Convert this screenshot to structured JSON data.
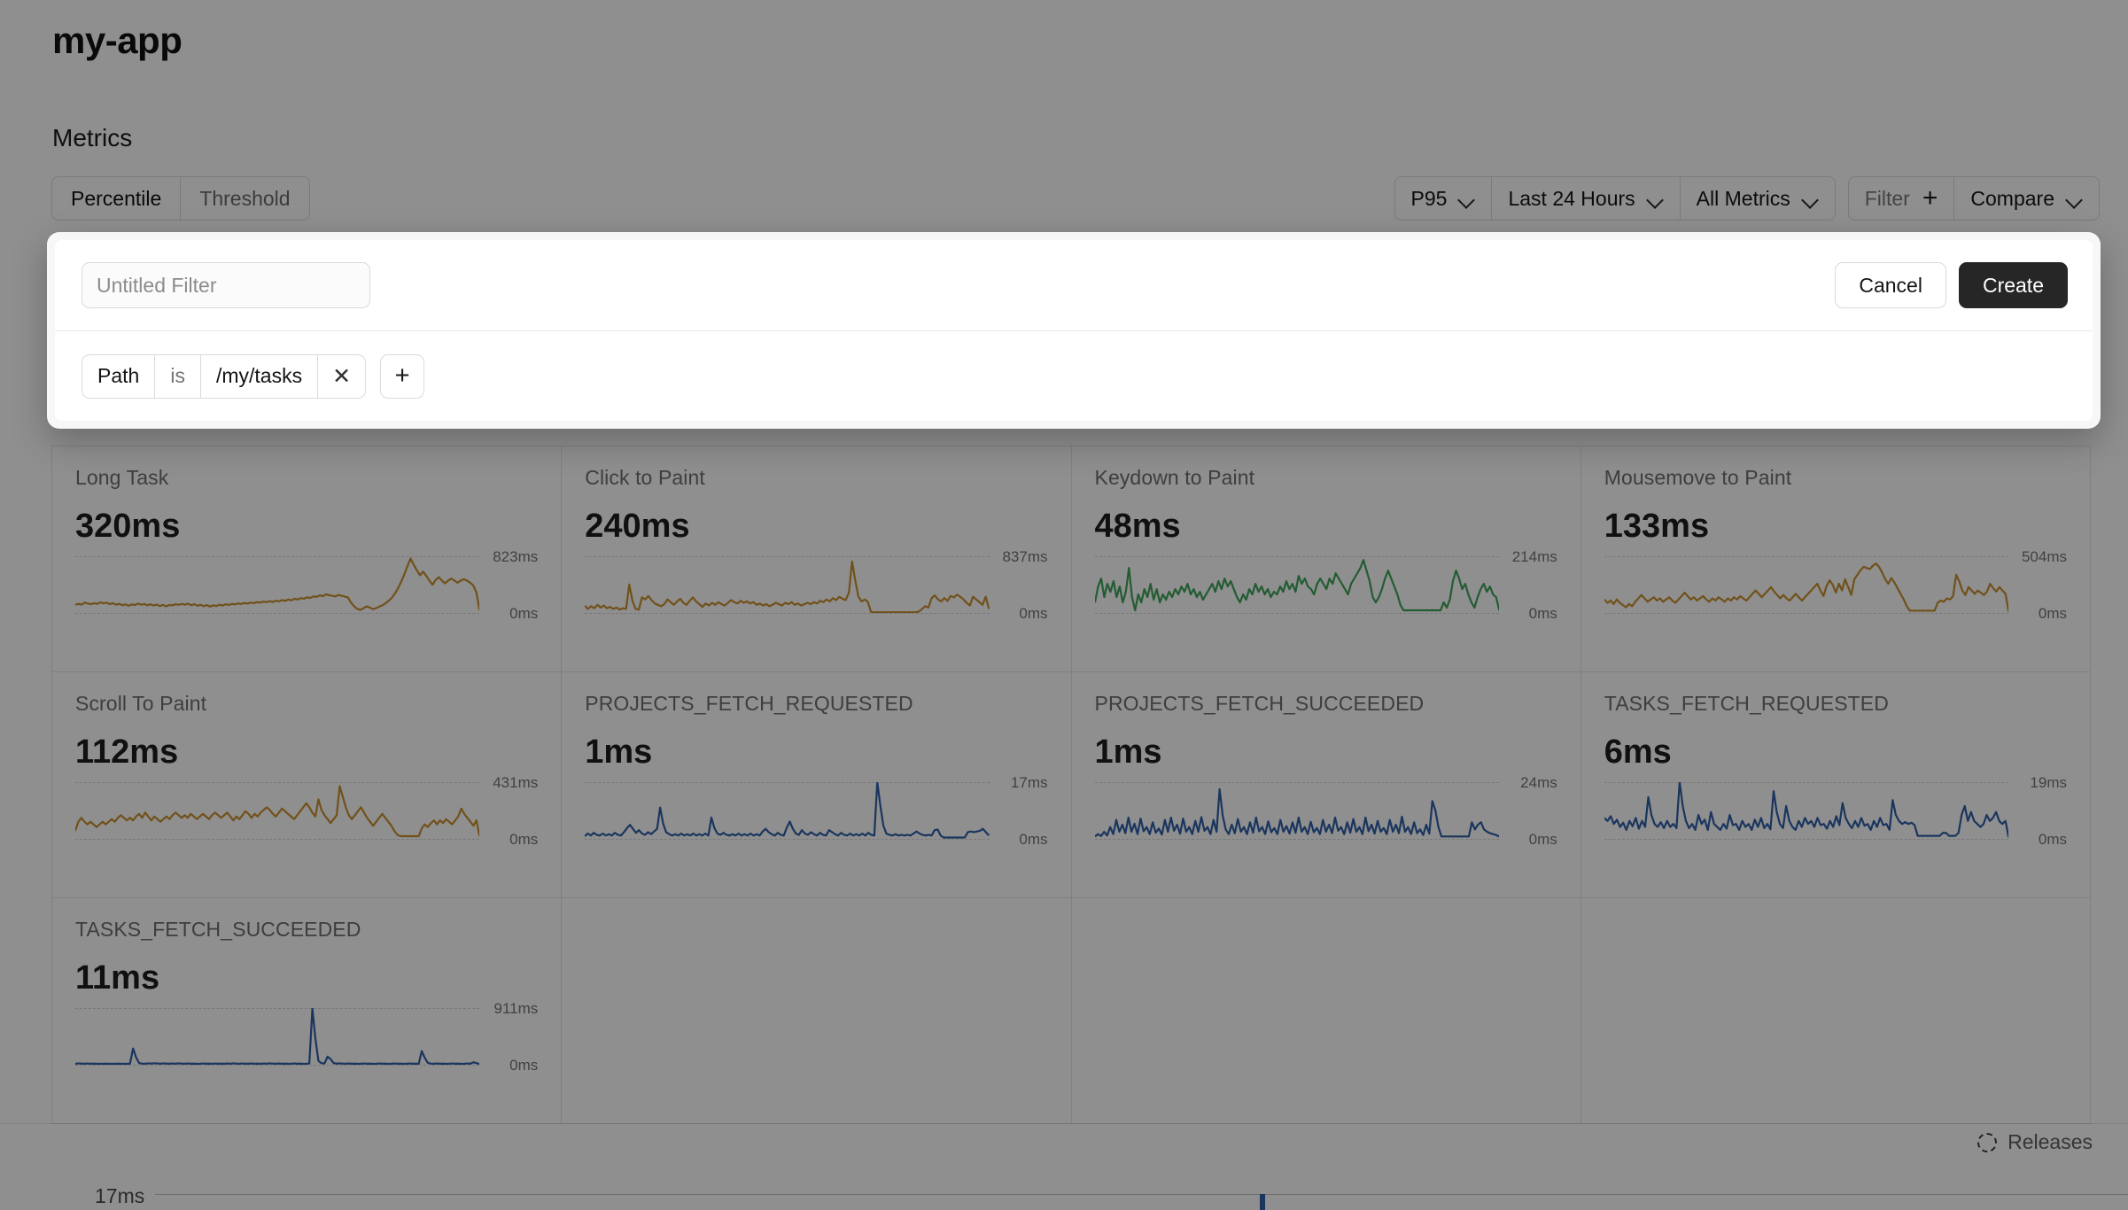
{
  "header": {
    "app_title": "my-app",
    "section_title": "Metrics"
  },
  "segmented": {
    "items": [
      {
        "label": "Percentile",
        "active": true
      },
      {
        "label": "Threshold",
        "active": false
      }
    ]
  },
  "toolbar": {
    "percentile": "P95",
    "time_range": "Last 24 Hours",
    "metric_scope": "All Metrics",
    "filter_label": "Filter",
    "add_filter_icon": "plus-icon",
    "compare_label": "Compare",
    "chevron_icon": "chevron-down-icon"
  },
  "modal": {
    "name_placeholder": "Untitled Filter",
    "name_value": "",
    "cancel_label": "Cancel",
    "create_label": "Create",
    "conditions": [
      {
        "field": "Path",
        "operator": "is",
        "value": "/my/tasks",
        "remove_icon": "close-icon"
      }
    ],
    "add_condition_icon": "plus-icon"
  },
  "bottom": {
    "releases_label": "Releases",
    "releases_icon": "dashed-circle-icon",
    "axis_label": "17ms"
  },
  "colors": {
    "amber": "#c9902f",
    "green": "#3fa45a",
    "blue": "#2f5fa8",
    "accent_dark": "#262626"
  },
  "chart_data": [
    {
      "type": "line",
      "title": "Long Task",
      "value": "320ms",
      "ymax_label": "823ms",
      "ymin_label": "0ms",
      "ylim": [
        0,
        823
      ],
      "color": "#c9902f",
      "highlighted": false,
      "values": [
        118,
        132,
        122,
        150,
        138,
        128,
        142,
        132,
        154,
        140,
        150,
        128,
        142,
        120,
        134,
        112,
        126,
        104,
        124,
        116,
        136,
        120,
        130,
        112,
        126,
        108,
        122,
        100,
        118,
        96,
        116,
        110,
        128,
        118,
        132,
        120,
        136,
        112,
        128,
        104,
        120,
        98,
        116,
        92,
        112,
        100,
        120,
        108,
        126,
        116,
        132,
        124,
        140,
        130,
        146,
        136,
        152,
        142,
        158,
        150,
        166,
        156,
        172,
        160,
        178,
        168,
        188,
        176,
        196,
        184,
        206,
        196,
        216,
        206,
        228,
        218,
        242,
        232,
        256,
        244,
        270,
        258,
        250,
        240,
        262,
        250,
        238,
        226,
        150,
        96,
        60,
        44,
        70,
        96,
        78,
        56,
        70,
        92,
        112,
        140,
        176,
        220,
        280,
        360,
        452,
        560,
        680,
        790,
        700,
        620,
        548,
        600,
        540,
        470,
        410,
        480,
        520,
        470,
        430,
        470,
        500,
        470,
        440,
        470,
        490,
        470,
        440,
        400,
        300,
        40
      ]
    },
    {
      "type": "line",
      "title": "Click to Paint",
      "value": "240ms",
      "ymax_label": "837ms",
      "ymin_label": "0ms",
      "ylim": [
        0,
        837
      ],
      "color": "#c9902f",
      "highlighted": false,
      "values": [
        110,
        60,
        100,
        70,
        120,
        80,
        110,
        70,
        90,
        60,
        80,
        50,
        70,
        60,
        420,
        180,
        60,
        50,
        230,
        200,
        250,
        190,
        140,
        120,
        100,
        130,
        200,
        160,
        120,
        170,
        210,
        150,
        120,
        180,
        230,
        170,
        130,
        90,
        140,
        110,
        150,
        120,
        160,
        130,
        110,
        150,
        190,
        160,
        140,
        180,
        150,
        170,
        140,
        160,
        120,
        140,
        110,
        130,
        100,
        120,
        150,
        130,
        110,
        150,
        130,
        160,
        120,
        140,
        110,
        130,
        150,
        130,
        160,
        140,
        180,
        160,
        200,
        170,
        220,
        190,
        240,
        210,
        190,
        300,
        760,
        480,
        240,
        170,
        200,
        160,
        10,
        10,
        10,
        10,
        10,
        10,
        10,
        10,
        10,
        10,
        10,
        10,
        10,
        10,
        10,
        20,
        60,
        100,
        80,
        220,
        260,
        200,
        170,
        220,
        180,
        250,
        230,
        270,
        240,
        200,
        150,
        110,
        240,
        200,
        160,
        120,
        240,
        60
      ]
    },
    {
      "type": "line",
      "title": "Keydown to Paint",
      "value": "48ms",
      "ymax_label": "214ms",
      "ymin_label": "0ms",
      "ylim": [
        0,
        214
      ],
      "color": "#3fa45a",
      "highlighted": false,
      "values": [
        40,
        100,
        130,
        60,
        110,
        80,
        120,
        60,
        100,
        40,
        80,
        170,
        60,
        10,
        70,
        40,
        90,
        60,
        110,
        50,
        90,
        40,
        70,
        50,
        80,
        60,
        90,
        70,
        100,
        80,
        110,
        70,
        90,
        60,
        80,
        50,
        70,
        90,
        110,
        80,
        120,
        90,
        130,
        100,
        120,
        90,
        60,
        40,
        70,
        50,
        90,
        70,
        110,
        80,
        100,
        70,
        90,
        60,
        80,
        70,
        100,
        80,
        120,
        90,
        110,
        80,
        140,
        110,
        130,
        100,
        90,
        70,
        110,
        130,
        110,
        90,
        130,
        110,
        150,
        130,
        110,
        90,
        70,
        110,
        130,
        150,
        170,
        200,
        160,
        120,
        60,
        40,
        60,
        90,
        130,
        160,
        130,
        100,
        70,
        30,
        10,
        10,
        10,
        10,
        10,
        10,
        10,
        10,
        10,
        10,
        10,
        10,
        10,
        40,
        20,
        50,
        120,
        160,
        130,
        90,
        110,
        70,
        40,
        20,
        60,
        90,
        110,
        80,
        100,
        70,
        60,
        10
      ]
    },
    {
      "type": "line",
      "title": "Mousemove to Paint",
      "value": "133ms",
      "ymax_label": "504ms",
      "ymin_label": "0ms",
      "ylim": [
        0,
        504
      ],
      "color": "#c9902f",
      "highlighted": false,
      "values": [
        120,
        90,
        110,
        80,
        120,
        90,
        70,
        50,
        80,
        60,
        100,
        130,
        160,
        130,
        100,
        120,
        140,
        110,
        130,
        100,
        120,
        140,
        110,
        90,
        120,
        150,
        180,
        150,
        120,
        140,
        110,
        130,
        150,
        120,
        100,
        130,
        110,
        140,
        120,
        100,
        130,
        110,
        140,
        120,
        150,
        130,
        110,
        140,
        170,
        200,
        170,
        140,
        170,
        200,
        230,
        190,
        160,
        130,
        160,
        130,
        110,
        140,
        170,
        140,
        110,
        140,
        170,
        200,
        230,
        260,
        200,
        150,
        240,
        290,
        250,
        180,
        260,
        200,
        300,
        230,
        160,
        300,
        340,
        380,
        410,
        400,
        390,
        420,
        440,
        410,
        360,
        300,
        260,
        310,
        270,
        220,
        170,
        120,
        60,
        20,
        20,
        20,
        20,
        20,
        20,
        20,
        20,
        20,
        90,
        110,
        100,
        130,
        120,
        150,
        340,
        280,
        200,
        160,
        230,
        200,
        170,
        200,
        180,
        160,
        190,
        260,
        220,
        190,
        230,
        200,
        170,
        10
      ]
    },
    {
      "type": "line",
      "title": "Scroll To Paint",
      "value": "112ms",
      "ymax_label": "431ms",
      "ymin_label": "0ms",
      "ylim": [
        0,
        431
      ],
      "color": "#c9902f",
      "highlighted": false,
      "values": [
        60,
        130,
        160,
        130,
        110,
        130,
        110,
        90,
        110,
        130,
        110,
        130,
        150,
        130,
        160,
        180,
        160,
        140,
        160,
        140,
        170,
        190,
        160,
        200,
        170,
        140,
        170,
        150,
        130,
        150,
        170,
        150,
        180,
        200,
        180,
        160,
        180,
        160,
        190,
        170,
        150,
        170,
        190,
        170,
        150,
        180,
        200,
        180,
        160,
        180,
        200,
        170,
        140,
        170,
        150,
        180,
        210,
        190,
        160,
        190,
        170,
        200,
        220,
        240,
        220,
        190,
        170,
        200,
        230,
        210,
        190,
        170,
        150,
        180,
        210,
        240,
        270,
        240,
        200,
        170,
        300,
        220,
        180,
        150,
        120,
        150,
        180,
        400,
        320,
        240,
        180,
        150,
        180,
        210,
        240,
        200,
        160,
        130,
        100,
        130,
        160,
        190,
        160,
        130,
        100,
        60,
        30,
        20,
        20,
        20,
        20,
        20,
        20,
        20,
        80,
        110,
        90,
        120,
        140,
        110,
        140,
        120,
        150,
        130,
        110,
        140,
        170,
        230,
        190,
        160,
        130,
        100,
        140,
        20
      ]
    },
    {
      "type": "line",
      "title": "PROJECTS_FETCH_REQUESTED",
      "value": "1ms",
      "ymax_label": "17ms",
      "ymin_label": "0ms",
      "ylim": [
        0,
        17
      ],
      "color": "#2f5fa8",
      "highlighted": true,
      "values": [
        0.8,
        1.6,
        1.0,
        1.8,
        1.2,
        1.0,
        1.6,
        1.0,
        1.4,
        1.0,
        1.8,
        1.2,
        1.0,
        2.0,
        3.2,
        4.2,
        3.0,
        1.8,
        2.6,
        1.6,
        1.2,
        2.0,
        1.4,
        2.2,
        3.0,
        9.4,
        4.6,
        2.0,
        1.4,
        1.0,
        1.4,
        1.0,
        1.6,
        1.0,
        1.4,
        1.0,
        1.6,
        1.0,
        1.4,
        1.0,
        1.6,
        1.0,
        6.4,
        3.2,
        1.6,
        1.2,
        1.8,
        1.2,
        1.0,
        1.4,
        1.0,
        1.6,
        1.0,
        1.4,
        1.0,
        1.6,
        1.0,
        1.4,
        1.0,
        2.2,
        3.0,
        2.0,
        1.4,
        1.0,
        1.8,
        1.2,
        1.0,
        3.4,
        5.2,
        3.0,
        1.6,
        1.2,
        2.6,
        1.6,
        1.2,
        2.0,
        1.4,
        1.0,
        1.8,
        1.2,
        1.0,
        2.6,
        2.0,
        1.4,
        1.0,
        1.8,
        1.2,
        1.0,
        1.6,
        1.0,
        1.4,
        1.0,
        1.6,
        1.0,
        1.8,
        1.2,
        1.0,
        17.0,
        10.0,
        4.0,
        1.6,
        1.2,
        1.0,
        1.4,
        1.0,
        1.2,
        1.0,
        1.2,
        1.0,
        1.6,
        2.2,
        1.6,
        1.2,
        1.0,
        1.2,
        1.0,
        2.6,
        2.8,
        1.0,
        0.4,
        0.4,
        0.4,
        0.4,
        0.4,
        0.4,
        0.4,
        0.4,
        2.0,
        2.2,
        2.0,
        2.2,
        2.4,
        3.0,
        2.0,
        1.0
      ]
    },
    {
      "type": "line",
      "title": "PROJECTS_FETCH_SUCCEEDED",
      "value": "1ms",
      "ymax_label": "24ms",
      "ymin_label": "0ms",
      "ylim": [
        0,
        24
      ],
      "color": "#2f5fa8",
      "highlighted": false,
      "values": [
        1.0,
        2.0,
        1.2,
        3.0,
        1.4,
        5.0,
        2.0,
        8.0,
        3.0,
        6.0,
        2.4,
        9.0,
        3.0,
        6.4,
        2.0,
        8.6,
        3.2,
        5.0,
        2.0,
        7.0,
        2.6,
        4.4,
        1.8,
        8.0,
        3.0,
        9.0,
        3.4,
        6.0,
        2.2,
        8.6,
        3.0,
        5.0,
        2.0,
        7.6,
        3.0,
        9.2,
        3.4,
        5.0,
        2.0,
        8.0,
        3.0,
        21.0,
        10.0,
        4.0,
        2.0,
        6.0,
        2.4,
        8.4,
        3.0,
        5.0,
        2.0,
        7.0,
        2.6,
        9.0,
        3.2,
        5.0,
        2.0,
        7.4,
        2.8,
        4.6,
        2.0,
        8.0,
        3.0,
        5.4,
        2.2,
        7.0,
        2.6,
        9.0,
        3.0,
        5.0,
        2.0,
        7.2,
        2.8,
        4.6,
        2.0,
        8.0,
        3.0,
        6.0,
        2.4,
        9.0,
        3.4,
        5.0,
        2.0,
        7.0,
        2.6,
        8.4,
        3.0,
        5.0,
        2.0,
        9.0,
        3.2,
        6.0,
        2.2,
        7.6,
        3.0,
        4.6,
        2.0,
        8.0,
        3.0,
        6.0,
        2.4,
        9.4,
        3.0,
        5.0,
        2.0,
        7.0,
        2.4,
        4.0,
        1.6,
        6.0,
        2.2,
        16.0,
        12.0,
        5.0,
        1.0,
        1.0,
        1.0,
        1.0,
        1.0,
        1.0,
        1.0,
        1.0,
        1.0,
        1.0,
        7.0,
        4.0,
        6.0,
        7.0,
        4.0,
        3.0,
        2.4,
        2.0,
        1.6,
        1.0
      ]
    },
    {
      "type": "line",
      "title": "TASKS_FETCH_REQUESTED",
      "value": "6ms",
      "ymax_label": "19ms",
      "ymin_label": "0ms",
      "ylim": [
        0,
        19
      ],
      "color": "#2f5fa8",
      "highlighted": false,
      "values": [
        7.0,
        6.0,
        7.6,
        5.0,
        6.4,
        4.0,
        5.4,
        3.0,
        6.0,
        4.2,
        7.0,
        3.4,
        6.0,
        4.0,
        14.0,
        8.0,
        5.0,
        4.0,
        5.6,
        3.6,
        6.0,
        4.0,
        5.0,
        3.6,
        19.0,
        11.0,
        6.0,
        3.6,
        5.0,
        3.0,
        8.0,
        5.0,
        6.4,
        3.0,
        9.0,
        5.0,
        4.0,
        3.0,
        5.0,
        3.4,
        8.0,
        4.6,
        5.0,
        3.0,
        6.0,
        4.0,
        5.0,
        3.0,
        6.4,
        4.0,
        7.0,
        3.6,
        5.0,
        3.2,
        16.0,
        9.0,
        5.0,
        3.6,
        11.0,
        6.0,
        4.0,
        3.0,
        6.0,
        4.0,
        7.0,
        5.0,
        6.0,
        4.0,
        7.0,
        4.6,
        5.0,
        3.4,
        6.0,
        4.0,
        7.6,
        4.6,
        12.0,
        7.0,
        5.0,
        3.6,
        6.0,
        4.0,
        7.0,
        4.4,
        5.0,
        3.0,
        6.0,
        4.0,
        7.0,
        4.6,
        5.0,
        3.0,
        13.0,
        8.0,
        6.0,
        5.0,
        5.6,
        5.0,
        5.4,
        4.6,
        1.0,
        1.0,
        1.0,
        1.0,
        1.0,
        1.0,
        1.0,
        1.0,
        2.0,
        2.0,
        1.0,
        1.0,
        1.0,
        2.0,
        8.0,
        11.0,
        6.0,
        9.0,
        6.0,
        5.0,
        4.0,
        5.0,
        8.0,
        6.0,
        7.0,
        9.0,
        6.0,
        5.0,
        6.0,
        0.5
      ]
    },
    {
      "type": "line",
      "title": "TASKS_FETCH_SUCCEEDED",
      "value": "11ms",
      "ymax_label": "911ms",
      "ymin_label": "0ms",
      "ylim": [
        0,
        911
      ],
      "color": "#2f5fa8",
      "highlighted": false,
      "values": [
        14,
        22,
        18,
        16,
        20,
        16,
        18,
        14,
        16,
        14,
        18,
        14,
        16,
        14,
        18,
        14,
        16,
        14,
        18,
        260,
        120,
        26,
        18,
        16,
        22,
        18,
        24,
        20,
        16,
        22,
        18,
        16,
        20,
        16,
        22,
        18,
        16,
        20,
        16,
        18,
        14,
        16,
        20,
        16,
        18,
        14,
        20,
        16,
        18,
        14,
        20,
        16,
        22,
        18,
        16,
        20,
        16,
        18,
        20,
        16,
        18,
        14,
        20,
        16,
        22,
        18,
        16,
        20,
        16,
        18,
        14,
        16,
        20,
        16,
        18,
        14,
        16,
        20,
        900,
        420,
        60,
        24,
        20,
        130,
        90,
        26,
        18,
        22,
        18,
        16,
        20,
        16,
        18,
        14,
        16,
        20,
        16,
        18,
        14,
        16,
        20,
        16,
        18,
        14,
        16,
        20,
        16,
        18,
        14,
        16,
        20,
        16,
        18,
        14,
        220,
        110,
        30,
        18,
        16,
        20,
        16,
        18,
        14,
        16,
        20,
        16,
        18,
        14,
        16,
        20,
        16,
        40,
        24,
        16
      ]
    }
  ]
}
